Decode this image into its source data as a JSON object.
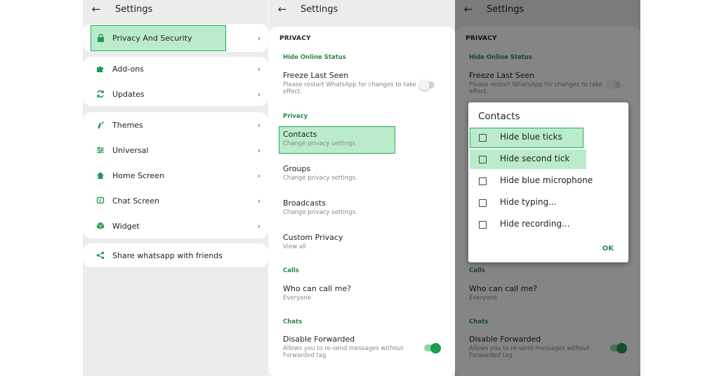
{
  "colors": {
    "accent": "#1f9b52",
    "highlight": "#82dca0",
    "toggle_on": "#1f9b52"
  },
  "panel1": {
    "title": "Settings",
    "back_icon": "arrow-left-icon",
    "items": [
      {
        "label": "Privacy And Security",
        "icon": "lock-icon"
      },
      {
        "label": "Add-ons",
        "icon": "puzzle-icon"
      },
      {
        "label": "Updates",
        "icon": "refresh-icon"
      },
      {
        "label": "Themes",
        "icon": "brush-icon"
      },
      {
        "label": "Universal",
        "icon": "sliders-icon"
      },
      {
        "label": "Home Screen",
        "icon": "home-icon"
      },
      {
        "label": "Chat Screen",
        "icon": "chat-icon"
      },
      {
        "label": "Widget",
        "icon": "widget-icon"
      },
      {
        "label": "Share whatsapp with friends",
        "icon": "share-icon"
      }
    ]
  },
  "panel2": {
    "title": "Settings",
    "header": "PRIVACY",
    "sections": {
      "hide_online": "Hide Online Status",
      "privacy": "Privacy",
      "calls": "Calls",
      "chats": "Chats"
    },
    "items": {
      "freeze": {
        "title": "Freeze Last Seen",
        "sub": "Please restart WhatsApp for changes to take effect."
      },
      "contacts": {
        "title": "Contacts",
        "sub": "Change privacy settings"
      },
      "groups": {
        "title": "Groups",
        "sub": "Change privacy settings."
      },
      "broadcasts": {
        "title": "Broadcasts",
        "sub": "Change privacy settings."
      },
      "custom": {
        "title": "Custom Privacy",
        "sub": "View all"
      },
      "who_call": {
        "title": "Who can call me?",
        "sub": "Everyone"
      },
      "forwarded": {
        "title": "Disable Forwarded",
        "sub": "Allows you to re-send messages without Forwarded tag"
      }
    },
    "toggles": {
      "freeze": false,
      "forwarded": true
    }
  },
  "panel3": {
    "title": "Settings",
    "header": "PRIVACY",
    "bg": {
      "hide_online": "Hide Online Status",
      "freeze_title": "Freeze Last Seen",
      "freeze_sub": "Please restart WhatsApp for changes to take effect.",
      "calls": "Calls",
      "who_call": "Who can call me?",
      "who_call_sub": "Everyone",
      "chats": "Chats",
      "forwarded": "Disable Forwarded",
      "forwarded_sub": "Allows you to re-send messages without Forwarded tag"
    },
    "dialog": {
      "title": "Contacts",
      "options": [
        "Hide blue ticks",
        "Hide second tick",
        "Hide blue microphone",
        "Hide typing...",
        "Hide recording..."
      ],
      "ok": "OK"
    }
  }
}
